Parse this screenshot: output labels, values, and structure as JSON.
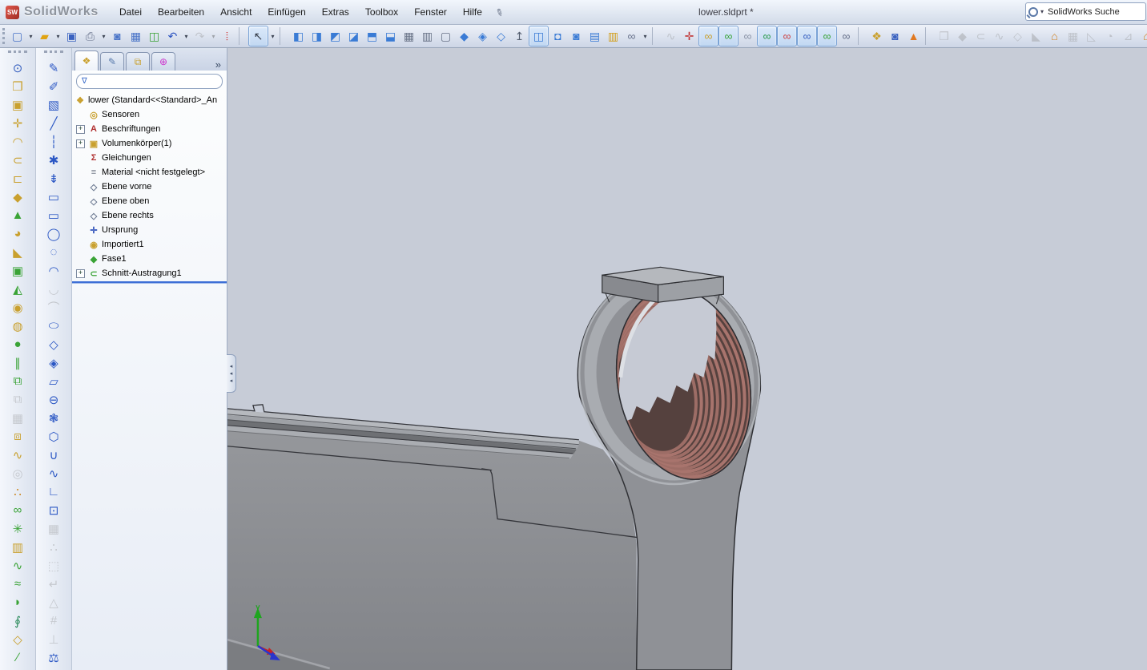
{
  "window": {
    "logo_text": "SolidWorks",
    "title": "lower.sldprt *"
  },
  "menubar": {
    "items": [
      "Datei",
      "Bearbeiten",
      "Ansicht",
      "Einfügen",
      "Extras",
      "Toolbox",
      "Fenster",
      "Hilfe"
    ],
    "pin_glyph": "✐"
  },
  "search": {
    "value": "SolidWorks Suche",
    "caret_glyph": "▾"
  },
  "main_toolbar": [
    {
      "n": "new-document",
      "g": "▢",
      "c": "#4a74c8"
    },
    {
      "n": "new-document-dropdown",
      "g": "▾",
      "t": "caret"
    },
    {
      "n": "open",
      "g": "▰",
      "c": "#e0a312"
    },
    {
      "n": "open-dropdown",
      "g": "▾",
      "t": "caret"
    },
    {
      "n": "save",
      "g": "▣",
      "c": "#3a62c0"
    },
    {
      "n": "print",
      "g": "⎙",
      "c": "#66708a"
    },
    {
      "n": "print-dropdown",
      "g": "▾",
      "t": "caret"
    },
    {
      "n": "print-preview",
      "g": "◙",
      "c": "#4a74c8"
    },
    {
      "n": "edit-properties",
      "g": "▦",
      "c": "#4a74c8"
    },
    {
      "n": "rebuild-check",
      "g": "◫",
      "c": "#3aa336"
    },
    {
      "n": "undo",
      "g": "↶",
      "c": "#2a52c0"
    },
    {
      "n": "undo-dropdown",
      "g": "▾",
      "t": "caret"
    },
    {
      "n": "redo",
      "g": "↷",
      "c": "#8a93a6",
      "s": "d"
    },
    {
      "n": "redo-dropdown",
      "g": "▾",
      "t": "caret",
      "s": "d"
    },
    {
      "n": "rebuild-traffic-light",
      "g": "⦙",
      "c": "#cc2222"
    },
    {
      "t": "sep"
    },
    {
      "n": "select-pointer",
      "g": "↖",
      "c": "#333a45",
      "s": "p"
    },
    {
      "n": "select-dropdown",
      "g": "▾",
      "t": "caret"
    },
    {
      "t": "sep"
    },
    {
      "n": "view-front",
      "g": "◧",
      "c": "#3a7bd5"
    },
    {
      "n": "view-back",
      "g": "◨",
      "c": "#3a7bd5"
    },
    {
      "n": "view-left",
      "g": "◩",
      "c": "#3a7bd5"
    },
    {
      "n": "view-right",
      "g": "◪",
      "c": "#3a7bd5"
    },
    {
      "n": "view-top",
      "g": "⬒",
      "c": "#3a7bd5"
    },
    {
      "n": "view-bottom",
      "g": "⬓",
      "c": "#3a7bd5"
    },
    {
      "n": "view-wireframe",
      "g": "▦",
      "c": "#6a7488"
    },
    {
      "n": "view-hidden-lines-visible",
      "g": "▥",
      "c": "#6a7488"
    },
    {
      "n": "view-hidden-lines-removed",
      "g": "▢",
      "c": "#6a7488"
    },
    {
      "n": "view-isometric",
      "g": "◆",
      "c": "#3a7bd5"
    },
    {
      "n": "view-dimetric",
      "g": "◈",
      "c": "#3a7bd5"
    },
    {
      "n": "view-trimetric",
      "g": "◇",
      "c": "#3a7bd5"
    },
    {
      "n": "section-view",
      "g": "↥",
      "c": "#555f70"
    },
    {
      "n": "view-orientation",
      "g": "◫",
      "c": "#3a7bd5",
      "s": "p"
    },
    {
      "n": "shaded-view",
      "g": "◘",
      "c": "#3a7bd5"
    },
    {
      "n": "display-style",
      "g": "◙",
      "c": "#3a7bd5"
    },
    {
      "n": "hide-show-items",
      "g": "▤",
      "c": "#3a7bd5"
    },
    {
      "n": "appearances",
      "g": "▥",
      "c": "#d3a020"
    },
    {
      "n": "view-sketch-relations",
      "g": "∞",
      "c": "#66708a"
    },
    {
      "n": "relations-dropdown",
      "g": "▾",
      "t": "caret"
    },
    {
      "t": "sep"
    },
    {
      "n": "reference-curve",
      "g": "∿",
      "c": "#8a93a6",
      "s": "d"
    },
    {
      "n": "move-triad",
      "g": "✛",
      "c": "#c03333"
    },
    {
      "n": "view-planes",
      "g": "∞",
      "c": "#c9a02e",
      "s": "p"
    },
    {
      "n": "view-axes",
      "g": "∞",
      "c": "#3aa336",
      "s": "p"
    },
    {
      "n": "view-temporary-axes",
      "g": "∞",
      "c": "#8a93a6"
    },
    {
      "n": "view-curves",
      "g": "∞",
      "c": "#2a9a4a",
      "s": "p"
    },
    {
      "n": "view-sketches",
      "g": "∞",
      "c": "#cc4444",
      "s": "p"
    },
    {
      "n": "view-annotations",
      "g": "∞",
      "c": "#3a62c0",
      "s": "p"
    },
    {
      "n": "view-points",
      "g": "∞",
      "c": "#3aa336",
      "s": "p"
    },
    {
      "n": "view-origins",
      "g": "∞",
      "c": "#66708a"
    },
    {
      "t": "sep"
    },
    {
      "n": "material-editor",
      "g": "❖",
      "c": "#c9a02e"
    },
    {
      "n": "photoview-preview",
      "g": "◙",
      "c": "#3a62c0"
    },
    {
      "n": "assembly-alert",
      "g": "▲",
      "c": "#e07820"
    },
    {
      "t": "sep"
    },
    {
      "n": "feature-extrude",
      "g": "❒",
      "c": "#8a93a6",
      "s": "d"
    },
    {
      "n": "feature-revolve",
      "g": "◆",
      "c": "#8a93a6",
      "s": "d"
    },
    {
      "n": "feature-sweep",
      "g": "⊂",
      "c": "#8a93a6",
      "s": "d"
    },
    {
      "n": "feature-loft",
      "g": "∿",
      "c": "#8a93a6",
      "s": "d"
    },
    {
      "n": "feature-boundary",
      "g": "◇",
      "c": "#8a93a6",
      "s": "d"
    },
    {
      "n": "feature-cut",
      "g": "◣",
      "c": "#8a93a6",
      "s": "d"
    },
    {
      "n": "sheet-metal-base-flange",
      "g": "⌂",
      "c": "#d08020"
    },
    {
      "n": "feature-pattern",
      "g": "▦",
      "c": "#8a93a6",
      "s": "d"
    },
    {
      "n": "feature-draft",
      "g": "◺",
      "c": "#8a93a6",
      "s": "d"
    },
    {
      "n": "feature-shell",
      "g": "◔",
      "c": "#8a93a6",
      "s": "d"
    },
    {
      "n": "feature-rib",
      "g": "⊿",
      "c": "#8a93a6",
      "s": "d"
    },
    {
      "n": "sheet-metal-edge-flange",
      "g": "⌂",
      "c": "#d08020"
    },
    {
      "n": "insert-bends",
      "g": "⤓",
      "c": "#8a93a6",
      "s": "d"
    }
  ],
  "left_toolbar_features": [
    {
      "n": "measure",
      "g": "⊙",
      "c": "#3a62c0"
    },
    {
      "n": "extruded-boss",
      "g": "❒",
      "c": "#c9a02e"
    },
    {
      "n": "extruded-cut",
      "g": "▣",
      "c": "#c9a02e"
    },
    {
      "n": "move-size-feature",
      "g": "✛",
      "c": "#c9a02e"
    },
    {
      "n": "dome",
      "g": "◠",
      "c": "#c9a02e"
    },
    {
      "n": "swept-cut",
      "g": "⊂",
      "c": "#c9a02e"
    },
    {
      "n": "lofted-cut",
      "g": "⊏",
      "c": "#c9a02e"
    },
    {
      "n": "boundary-boss",
      "g": "◆",
      "c": "#c9a02e"
    },
    {
      "n": "wrap",
      "g": "▲",
      "c": "#3aa336"
    },
    {
      "n": "fillet",
      "g": "◕",
      "c": "#c9a02e"
    },
    {
      "n": "chamfer",
      "g": "◣",
      "c": "#c9a02e"
    },
    {
      "n": "indent",
      "g": "▣",
      "c": "#3aa336"
    },
    {
      "n": "draft",
      "g": "◭",
      "c": "#3aa336"
    },
    {
      "n": "hole-wizard",
      "g": "◉",
      "c": "#c9a02e"
    },
    {
      "n": "revolved-boss",
      "g": "◍",
      "c": "#c9a02e"
    },
    {
      "n": "dome-sphere",
      "g": "●",
      "c": "#3aa336"
    },
    {
      "n": "linear-pattern",
      "g": "∥",
      "c": "#3aa336"
    },
    {
      "n": "mirror-feature",
      "g": "⧉",
      "c": "#3aa336"
    },
    {
      "n": "pattern-unavailable-1",
      "g": "⧉",
      "c": "#8a93a6",
      "s": "d"
    },
    {
      "n": "pattern-unavailable-2",
      "g": "▦",
      "c": "#8a93a6",
      "s": "d"
    },
    {
      "n": "combine-bodies",
      "g": "⧈",
      "c": "#c9a02e"
    },
    {
      "n": "flex",
      "g": "∿",
      "c": "#c9a02e"
    },
    {
      "n": "circular-pattern",
      "g": "◎",
      "c": "#8a93a6",
      "s": "d"
    },
    {
      "n": "sketch-driven-pattern",
      "g": "∴",
      "c": "#cc8822"
    },
    {
      "n": "curve-driven-pattern",
      "g": "∞",
      "c": "#3aa336"
    },
    {
      "n": "fill-pattern",
      "g": "✳",
      "c": "#3aa336"
    },
    {
      "n": "table-driven-pattern",
      "g": "▥",
      "c": "#c9a02e"
    },
    {
      "n": "spline-feature",
      "g": "∿",
      "c": "#3aa336"
    },
    {
      "n": "rib",
      "g": "≈",
      "c": "#3aa336"
    },
    {
      "n": "shell",
      "g": "◗",
      "c": "#3aa336"
    },
    {
      "n": "helix-spiral",
      "g": "∮",
      "c": "#2a8a5a"
    },
    {
      "n": "reference-plane",
      "g": "◇",
      "c": "#c9a02e"
    },
    {
      "n": "reference-axis",
      "g": "∕",
      "c": "#3aa336"
    }
  ],
  "left_toolbar_sketch": [
    {
      "n": "sketch",
      "g": "✎",
      "c": "#2b57c4"
    },
    {
      "n": "sketch-3d",
      "g": "✐",
      "c": "#2b57c4"
    },
    {
      "n": "sketch-picture",
      "g": "▧",
      "c": "#2b57c4"
    },
    {
      "n": "line",
      "g": "╱",
      "c": "#2b57c4"
    },
    {
      "n": "centerline",
      "g": "┆",
      "c": "#2b57c4"
    },
    {
      "n": "point",
      "g": "✱",
      "c": "#2b57c4"
    },
    {
      "n": "ink-sketch",
      "g": "⇟",
      "c": "#2b57c4"
    },
    {
      "n": "corner-rectangle",
      "g": "▭",
      "c": "#2b57c4"
    },
    {
      "n": "center-rectangle",
      "g": "▭",
      "c": "#2b57c4"
    },
    {
      "n": "circle",
      "g": "◯",
      "c": "#2b57c4"
    },
    {
      "n": "perimeter-circle",
      "g": "◌",
      "c": "#2b57c4"
    },
    {
      "n": "three-point-arc",
      "g": "◠",
      "c": "#2b57c4"
    },
    {
      "n": "tangent-arc",
      "g": "◡",
      "c": "#8a93a6",
      "s": "d"
    },
    {
      "n": "centerpoint-arc",
      "g": "⌒",
      "c": "#8a93a6",
      "s": "d"
    },
    {
      "n": "ellipse",
      "g": "⬭",
      "c": "#2b57c4"
    },
    {
      "n": "polygon",
      "g": "◇",
      "c": "#2b57c4"
    },
    {
      "n": "rhombus",
      "g": "◈",
      "c": "#2b57c4"
    },
    {
      "n": "parallelogram",
      "g": "▱",
      "c": "#2b57c4"
    },
    {
      "n": "straight-slot",
      "g": "⊖",
      "c": "#2b57c4"
    },
    {
      "n": "freeform-region",
      "g": "❃",
      "c": "#2b57c4"
    },
    {
      "n": "hexagon",
      "g": "⬡",
      "c": "#2b57c4"
    },
    {
      "n": "spline-u",
      "g": "∪",
      "c": "#2b57c4"
    },
    {
      "n": "spline",
      "g": "∿",
      "c": "#2b57c4"
    },
    {
      "n": "corner-fillet",
      "g": "∟",
      "c": "#2b57c4"
    },
    {
      "n": "boxed-spline",
      "g": "⊡",
      "c": "#2b57c4"
    },
    {
      "n": "linear-sketch-pattern",
      "g": "▦",
      "c": "#8a93a6",
      "s": "d"
    },
    {
      "n": "circular-sketch-pattern",
      "g": "∴",
      "c": "#8a93a6",
      "s": "d"
    },
    {
      "n": "convert-entities",
      "g": "⬚",
      "c": "#8a93a6",
      "s": "d"
    },
    {
      "n": "offset-entities",
      "g": "↵",
      "c": "#8a93a6",
      "s": "d"
    },
    {
      "n": "sketch-alert",
      "g": "△",
      "c": "#8a93a6",
      "s": "d"
    },
    {
      "n": "trim-entities",
      "g": "#",
      "c": "#8a93a6",
      "s": "d"
    },
    {
      "n": "extend-entities",
      "g": "⊥",
      "c": "#8a93a6",
      "s": "d"
    },
    {
      "n": "scale-entities",
      "g": "⚖",
      "c": "#2b57c4"
    }
  ],
  "feature_panel": {
    "tabs": [
      {
        "n": "tab-featuremanager",
        "g": "❖",
        "c": "#c9a02e",
        "a": "active"
      },
      {
        "n": "tab-propertymanager",
        "g": "✎",
        "c": "#5577aa"
      },
      {
        "n": "tab-configurationmanager",
        "g": "⧉",
        "c": "#c9a02e"
      },
      {
        "n": "tab-dimxpertmanager",
        "g": "⊕",
        "c": "#cc33cc"
      }
    ],
    "overflow_chevron": "»",
    "filter_glyph": "∇",
    "tree": [
      {
        "label": "lower (Standard<<Standard>_An",
        "n": "tree-item-lower",
        "g": "❖",
        "c": "#c9a02e",
        "k": "root"
      },
      {
        "label": "Sensoren",
        "n": "tree-item-sensoren",
        "g": "◎",
        "c": "#c9a02e"
      },
      {
        "label": "Beschriftungen",
        "n": "tree-item-beschriftungen",
        "g": "A",
        "c": "#b03030",
        "x": "exp"
      },
      {
        "label": "Volumenkörper(1)",
        "n": "tree-item-volumenkoerper",
        "g": "▣",
        "c": "#c9a02e",
        "x": "exp"
      },
      {
        "label": "Gleichungen",
        "n": "tree-item-gleichungen",
        "g": "Σ",
        "c": "#b03030"
      },
      {
        "label": "Material <nicht festgelegt>",
        "n": "tree-item-material",
        "g": "≡",
        "c": "#777e8c"
      },
      {
        "label": "Ebene vorne",
        "n": "tree-item-ebene-vorne",
        "g": "◇",
        "c": "#6b7890"
      },
      {
        "label": "Ebene oben",
        "n": "tree-item-ebene-oben",
        "g": "◇",
        "c": "#6b7890"
      },
      {
        "label": "Ebene rechts",
        "n": "tree-item-ebene-rechts",
        "g": "◇",
        "c": "#6b7890"
      },
      {
        "label": "Ursprung",
        "n": "tree-item-ursprung",
        "g": "✛",
        "c": "#3355bb"
      },
      {
        "label": "Importiert1",
        "n": "tree-item-importiert1",
        "g": "◉",
        "c": "#c9a02e"
      },
      {
        "label": "Fase1",
        "n": "tree-item-fase1",
        "g": "◆",
        "c": "#3aa336"
      },
      {
        "label": "Schnitt-Austragung1",
        "n": "tree-item-schnitt-austragung1",
        "g": "⊂",
        "c": "#3aa336",
        "x": "exp"
      }
    ]
  },
  "viewport": {
    "part_color": "#8f9196",
    "thread_color": "#9d6d66",
    "background": "#c7ccd7",
    "axis_colors": {
      "x": "#cc2020",
      "y": "#1fa51f",
      "z": "#2a35cc"
    }
  }
}
